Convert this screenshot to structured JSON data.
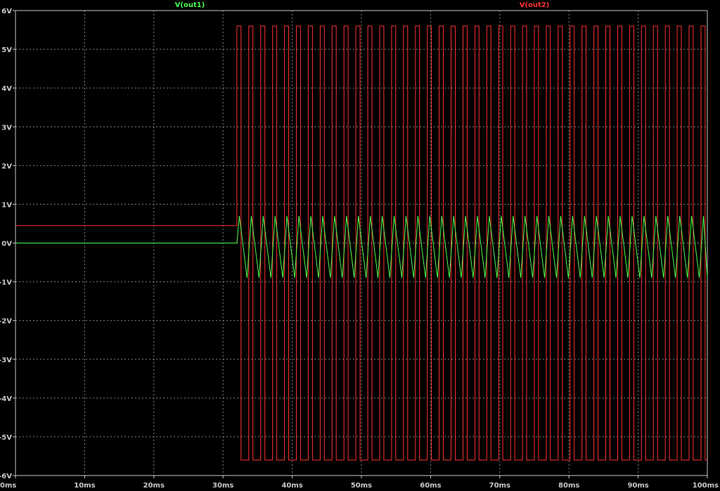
{
  "chart_data": {
    "type": "line",
    "title": "",
    "xlabel": "",
    "ylabel": "",
    "xlim": [
      0,
      100
    ],
    "ylim": [
      -6,
      6
    ],
    "x_unit": "ms",
    "y_unit": "V",
    "grid": true,
    "x_ticks": [
      "0ms",
      "10ms",
      "20ms",
      "30ms",
      "40ms",
      "50ms",
      "60ms",
      "70ms",
      "80ms",
      "90ms",
      "100ms"
    ],
    "x_tick_values": [
      0,
      10,
      20,
      30,
      40,
      50,
      60,
      70,
      80,
      90,
      100
    ],
    "y_ticks": [
      "6V",
      "5V",
      "4V",
      "3V",
      "2V",
      "1V",
      "0V",
      "-1V",
      "-2V",
      "-3V",
      "-4V",
      "-5V",
      "-6V"
    ],
    "y_tick_values": [
      6,
      5,
      4,
      3,
      2,
      1,
      0,
      -1,
      -2,
      -3,
      -4,
      -5,
      -6
    ],
    "series": [
      {
        "name": "V(out1)",
        "color": "#4cff4c",
        "shape": "triangle",
        "initial_value": 0,
        "start_ms": 32,
        "end_ms": 100,
        "period_ms": 1.72,
        "high": 0.7,
        "low": -0.9,
        "rise_fraction": 0.35
      },
      {
        "name": "V(out2)",
        "color": "#ff3030",
        "shape": "square",
        "initial_value": 0.45,
        "start_ms": 32,
        "end_ms": 100,
        "period_ms": 1.72,
        "high": 5.6,
        "low": -5.6,
        "duty": 0.35
      }
    ]
  }
}
